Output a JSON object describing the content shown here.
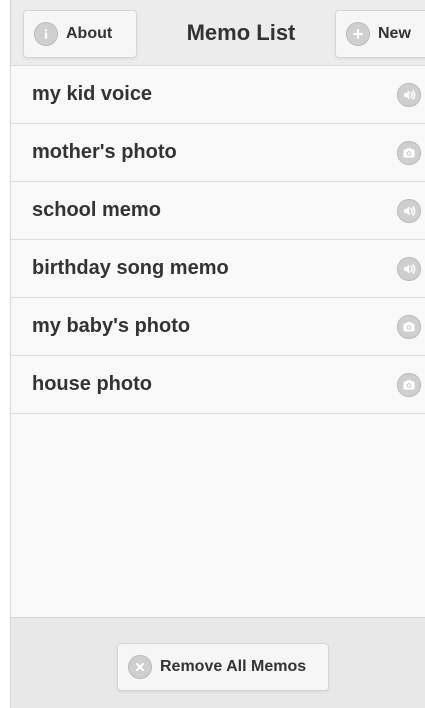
{
  "header": {
    "about_label": "About",
    "title": "Memo List",
    "new_label": "New"
  },
  "memos": [
    {
      "label": "my kid voice",
      "type": "audio"
    },
    {
      "label": "mother's photo",
      "type": "photo"
    },
    {
      "label": "school memo",
      "type": "audio"
    },
    {
      "label": "birthday song memo",
      "type": "audio"
    },
    {
      "label": "my baby's photo",
      "type": "photo"
    },
    {
      "label": "house photo",
      "type": "photo"
    }
  ],
  "footer": {
    "remove_all_label": "Remove All Memos"
  },
  "icons": {
    "about": "info-icon",
    "new": "plus-icon",
    "audio": "speaker-icon",
    "photo": "camera-icon",
    "remove": "x-icon"
  },
  "colors": {
    "header_bg": "#ececec",
    "list_bg": "#f9f9f9",
    "footer_bg": "#e8e8e8",
    "text": "#333333",
    "icon_bg": "#cfcfcf"
  }
}
